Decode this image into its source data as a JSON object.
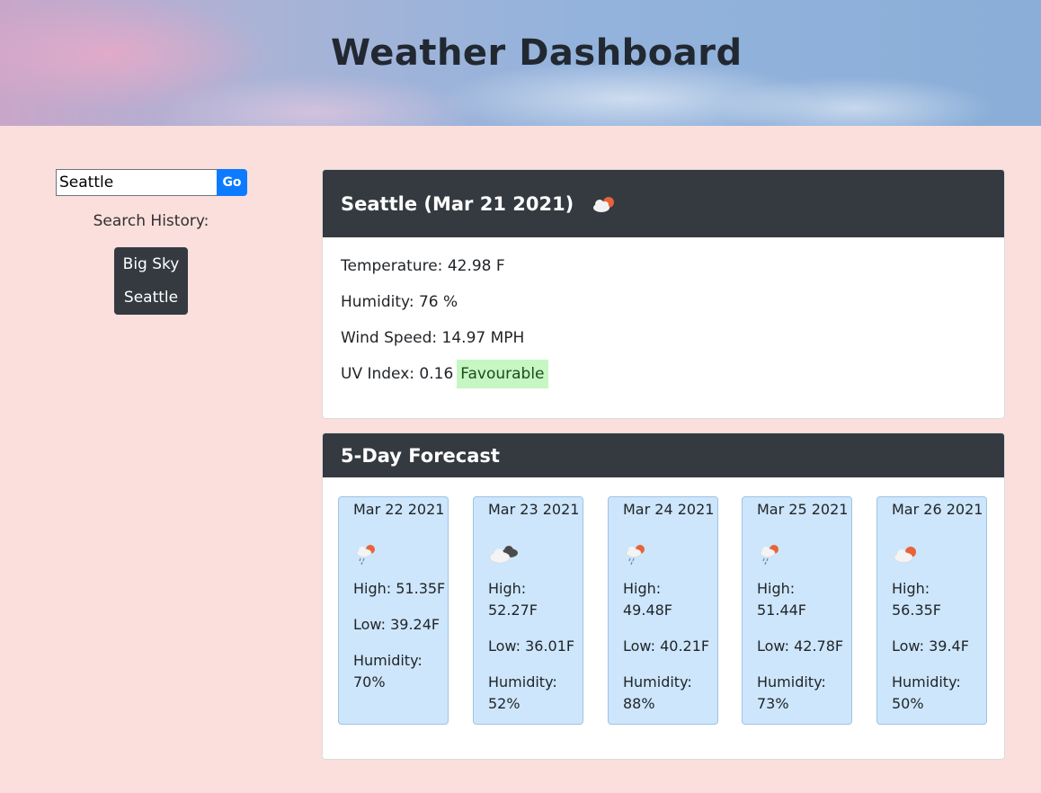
{
  "header": {
    "title": "Weather Dashboard"
  },
  "search": {
    "value": "Seattle",
    "go_label": "Go"
  },
  "history": {
    "label": "Search History:",
    "items": [
      "Big Sky",
      "Seattle"
    ]
  },
  "current": {
    "heading": "Seattle (Mar 21 2021)",
    "icon": "cloud-sun-icon",
    "temperature": "Temperature: 42.98 F",
    "humidity": "Humidity: 76 %",
    "wind": "Wind Speed: 14.97 MPH",
    "uv_label": "UV Index: 0.16",
    "uv_status": "Favourable",
    "uv_color": "#c6f7c2"
  },
  "forecast": {
    "heading": "5-Day Forecast",
    "days": [
      {
        "date": "Mar 22 2021",
        "icon": "rain-sun-icon",
        "high": "High: 51.35F",
        "low": "Low: 39.24F",
        "humidity": "Humidity: 70%"
      },
      {
        "date": "Mar 23 2021",
        "icon": "cloudy-icon",
        "high": "High: 52.27F",
        "low": "Low: 36.01F",
        "humidity": "Humidity: 52%"
      },
      {
        "date": "Mar 24 2021",
        "icon": "rain-sun-icon",
        "high": "High: 49.48F",
        "low": "Low: 40.21F",
        "humidity": "Humidity: 88%"
      },
      {
        "date": "Mar 25 2021",
        "icon": "rain-sun-icon",
        "high": "High: 51.44F",
        "low": "Low: 42.78F",
        "humidity": "Humidity: 73%"
      },
      {
        "date": "Mar 26 2021",
        "icon": "cloud-sun-icon",
        "high": "High: 56.35F",
        "low": "Low: 39.4F",
        "humidity": "Humidity: 50%"
      }
    ]
  },
  "colors": {
    "accent": "#0d7bff",
    "dark": "#343a40",
    "page_bg": "#fbdfdc",
    "forecast_bg": "#cde6fb"
  }
}
